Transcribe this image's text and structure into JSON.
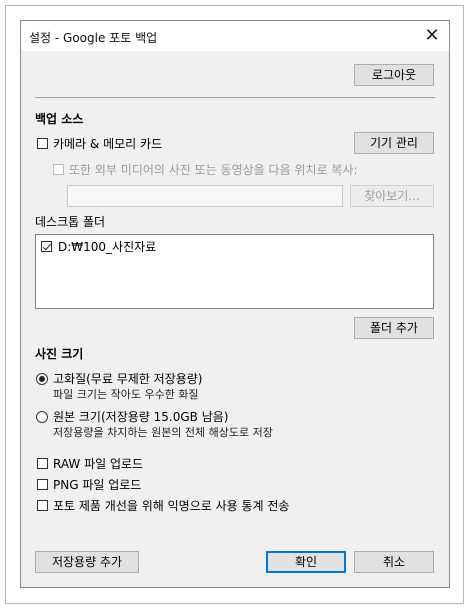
{
  "window": {
    "title": "설정 - Google 포토 백업",
    "close_symbol": "✕"
  },
  "account": {
    "logout_label": "로그아웃"
  },
  "backup_source": {
    "heading": "백업 소스",
    "camera_card": {
      "label": "카메라 & 메모리 카드",
      "checked": false
    },
    "manage_devices_label": "기기 관리",
    "external_media": {
      "label": "또한 외부 미디어의 사진 또는 동영상을 다음 위치로 복사:",
      "checked": false,
      "enabled": false
    },
    "path_value": "",
    "browse_label": "찾아보기..."
  },
  "desktop_folders": {
    "heading": "데스크톱 폴더",
    "items": [
      {
        "label": "D:₩100_사진자료",
        "checked": true
      }
    ],
    "add_folder_label": "폴더 추가"
  },
  "photo_size": {
    "heading": "사진 크기",
    "options": [
      {
        "label": "고화질(무료 무제한 저장용량)",
        "desc": "파일 크기는 작아도 우수한 화질",
        "selected": true
      },
      {
        "label": "원본 크기(저장용량 15.0GB 남음)",
        "desc": "저장용량을 차지하는 원본의 전체 해상도로 저장",
        "selected": false
      }
    ]
  },
  "uploads": [
    {
      "label": "RAW 파일 업로드",
      "checked": false
    },
    {
      "label": "PNG 파일 업로드",
      "checked": false
    },
    {
      "label": "포토 제품 개선을 위해 익명으로 사용 통계 전송",
      "checked": false
    }
  ],
  "footer": {
    "add_storage_label": "저장용량 추가",
    "ok_label": "확인",
    "cancel_label": "취소"
  }
}
